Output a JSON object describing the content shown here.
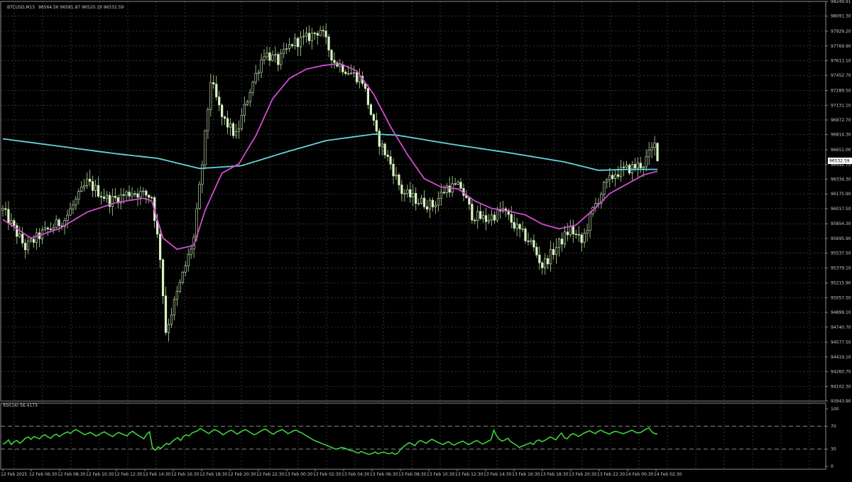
{
  "header": {
    "symbol": "BTCUSD,M15",
    "ohlc": "96564.56 96581.87 96520.19 96532.59"
  },
  "rsi_panel": {
    "label": "RSI(14) 56.4173"
  },
  "colors": {
    "background": "#000000",
    "candle": "#d9f5c4",
    "wick": "#b5e09a",
    "ma_fast": "#d24bd2",
    "ma_slow": "#63d3de",
    "rsi_line": "#3ecf3e",
    "price_tag_bg": "#ffffff",
    "price_tag_text": "#000000"
  },
  "chart_data": [
    {
      "type": "candlestick",
      "title": "",
      "ylim": [
        93943.9,
        98249.9
      ],
      "y_ticks": [
        "98249.91",
        "98091.30",
        "97929.20",
        "97769.90",
        "97611.10",
        "97452.70",
        "97289.50",
        "97131.10",
        "96972.70",
        "96814.30",
        "96651.00",
        "96492.70",
        "96334.30",
        "96175.90",
        "96017.50",
        "95854.30",
        "95695.90",
        "95537.50",
        "95379.10",
        "95215.90",
        "95057.50",
        "94899.10",
        "94740.70",
        "94577.50",
        "94419.10",
        "94260.70",
        "94102.30",
        "93943.90"
      ],
      "y_tick_values": [
        98249.9,
        98091.3,
        97929.2,
        97769.9,
        97611.1,
        97452.7,
        97289.5,
        97131.1,
        96972.7,
        96814.3,
        96651.0,
        96492.7,
        96334.3,
        96175.9,
        96017.5,
        95854.3,
        95695.9,
        95537.5,
        95379.1,
        95215.9,
        95057.5,
        94899.1,
        94740.7,
        94577.5,
        94419.1,
        94260.7,
        94102.3,
        93943.9
      ],
      "x_ticks": [
        "12 Feb 2025",
        "12 Feb 06:30",
        "12 Feb 08:30",
        "12 Feb 10:30",
        "12 Feb 12:30",
        "12 Feb 14:30",
        "12 Feb 16:30",
        "12 Feb 18:30",
        "12 Feb 20:30",
        "12 Feb 22:30",
        "13 Feb 00:30",
        "13 Feb 02:30",
        "13 Feb 04:30",
        "13 Feb 06:30",
        "13 Feb 08:30",
        "13 Feb 10:30",
        "13 Feb 12:30",
        "13 Feb 14:30",
        "13 Feb 16:30",
        "13 Feb 18:30",
        "13 Feb 20:30",
        "13 Feb 22:30",
        "14 Feb 00:30",
        "14 Feb 02:30"
      ],
      "last_price": "96532.59",
      "last_price_value": 96532.59,
      "close_anchors": [
        [
          0,
          96000
        ],
        [
          8,
          95600
        ],
        [
          14,
          95750
        ],
        [
          22,
          95900
        ],
        [
          30,
          96300
        ],
        [
          38,
          96100
        ],
        [
          46,
          96200
        ],
        [
          53,
          96150
        ],
        [
          56,
          95500
        ],
        [
          58,
          94700
        ],
        [
          62,
          95100
        ],
        [
          68,
          95700
        ],
        [
          71,
          96500
        ],
        [
          74,
          97400
        ],
        [
          78,
          97000
        ],
        [
          83,
          96800
        ],
        [
          88,
          97300
        ],
        [
          93,
          97700
        ],
        [
          98,
          97600
        ],
        [
          103,
          97800
        ],
        [
          108,
          97850
        ],
        [
          113,
          97950
        ],
        [
          118,
          97600
        ],
        [
          123,
          97500
        ],
        [
          128,
          97400
        ],
        [
          133,
          96800
        ],
        [
          138,
          96500
        ],
        [
          142,
          96200
        ],
        [
          148,
          96100
        ],
        [
          153,
          96050
        ],
        [
          158,
          96250
        ],
        [
          163,
          96250
        ],
        [
          167,
          95950
        ],
        [
          172,
          95900
        ],
        [
          178,
          96000
        ],
        [
          183,
          95800
        ],
        [
          188,
          95650
        ],
        [
          192,
          95400
        ],
        [
          197,
          95600
        ],
        [
          202,
          95800
        ],
        [
          206,
          95650
        ],
        [
          210,
          96000
        ],
        [
          214,
          96250
        ],
        [
          218,
          96400
        ],
        [
          223,
          96450
        ],
        [
          228,
          96500
        ],
        [
          232,
          96700
        ],
        [
          233,
          96532.59
        ]
      ],
      "ma_fast_anchors": [
        [
          0,
          95900
        ],
        [
          10,
          95700
        ],
        [
          20,
          95800
        ],
        [
          30,
          95980
        ],
        [
          40,
          96080
        ],
        [
          50,
          96130
        ],
        [
          53,
          96100
        ],
        [
          57,
          95700
        ],
        [
          62,
          95580
        ],
        [
          68,
          95620
        ],
        [
          72,
          96000
        ],
        [
          78,
          96400
        ],
        [
          84,
          96500
        ],
        [
          90,
          96800
        ],
        [
          96,
          97200
        ],
        [
          102,
          97420
        ],
        [
          108,
          97520
        ],
        [
          114,
          97560
        ],
        [
          120,
          97580
        ],
        [
          126,
          97500
        ],
        [
          132,
          97250
        ],
        [
          138,
          96900
        ],
        [
          144,
          96600
        ],
        [
          150,
          96340
        ],
        [
          156,
          96250
        ],
        [
          162,
          96230
        ],
        [
          168,
          96100
        ],
        [
          174,
          96020
        ],
        [
          180,
          95990
        ],
        [
          186,
          95950
        ],
        [
          192,
          95850
        ],
        [
          198,
          95800
        ],
        [
          204,
          95840
        ],
        [
          210,
          96000
        ],
        [
          216,
          96180
        ],
        [
          222,
          96280
        ],
        [
          228,
          96380
        ],
        [
          233,
          96420
        ]
      ],
      "ma_slow_anchors": [
        [
          0,
          96770
        ],
        [
          20,
          96690
        ],
        [
          40,
          96610
        ],
        [
          55,
          96560
        ],
        [
          70,
          96450
        ],
        [
          85,
          96480
        ],
        [
          100,
          96620
        ],
        [
          115,
          96750
        ],
        [
          132,
          96820
        ],
        [
          140,
          96810
        ],
        [
          160,
          96710
        ],
        [
          180,
          96620
        ],
        [
          200,
          96520
        ],
        [
          212,
          96430
        ],
        [
          222,
          96440
        ],
        [
          233,
          96440
        ]
      ]
    },
    {
      "type": "line",
      "title": "",
      "ylim": [
        0,
        100
      ],
      "y_ticks": [
        "100",
        "70",
        "30",
        "0"
      ],
      "y_tick_values": [
        100,
        70,
        30,
        0
      ],
      "levels": [
        70,
        30
      ],
      "series": [
        {
          "values": [
            39,
            41,
            46,
            38,
            43,
            45,
            40,
            44,
            49,
            51,
            47,
            52,
            50,
            48,
            53,
            55,
            51,
            49,
            54,
            56,
            52,
            55,
            58,
            60,
            57,
            62,
            64,
            61,
            58,
            55,
            57,
            59,
            56,
            53,
            55,
            58,
            60,
            57,
            54,
            52,
            56,
            59,
            57,
            55,
            53,
            58,
            61,
            57,
            54,
            51,
            48,
            56,
            60,
            33,
            28,
            34,
            31,
            36,
            40,
            38,
            43,
            47,
            50,
            45,
            52,
            55,
            53,
            58,
            60,
            62,
            66,
            63,
            60,
            57,
            61,
            64,
            62,
            59,
            55,
            58,
            61,
            63,
            60,
            56,
            59,
            62,
            64,
            61,
            58,
            55,
            57,
            60,
            63,
            65,
            62,
            58,
            56,
            60,
            62,
            64,
            61,
            57,
            59,
            62,
            63,
            60,
            58,
            55,
            52,
            49,
            46,
            44,
            42,
            40,
            38,
            36,
            34,
            32,
            30,
            31,
            33,
            32,
            30,
            28,
            27,
            25,
            23,
            26,
            24,
            22,
            21,
            23,
            25,
            22,
            24,
            25,
            23,
            22,
            24,
            21,
            23,
            30,
            34,
            38,
            41,
            39,
            36,
            42,
            45,
            43,
            40,
            44,
            47,
            45,
            42,
            40,
            38,
            41,
            43,
            39,
            37,
            40,
            42,
            44,
            41,
            38,
            40,
            43,
            45,
            42,
            39,
            41,
            44,
            46,
            63,
            53,
            47,
            44,
            46,
            49,
            43,
            40,
            37,
            33,
            35,
            37,
            39,
            41,
            38,
            44,
            46,
            43,
            45,
            48,
            51,
            49,
            46,
            53,
            58,
            50,
            48,
            54,
            57,
            55,
            52,
            55,
            58,
            60,
            62,
            59,
            57,
            61,
            63,
            60,
            58,
            56,
            59,
            61,
            60,
            58,
            57,
            59,
            61,
            63,
            60,
            58,
            59,
            62,
            65,
            67,
            60,
            57,
            56.4
          ]
        }
      ]
    }
  ]
}
